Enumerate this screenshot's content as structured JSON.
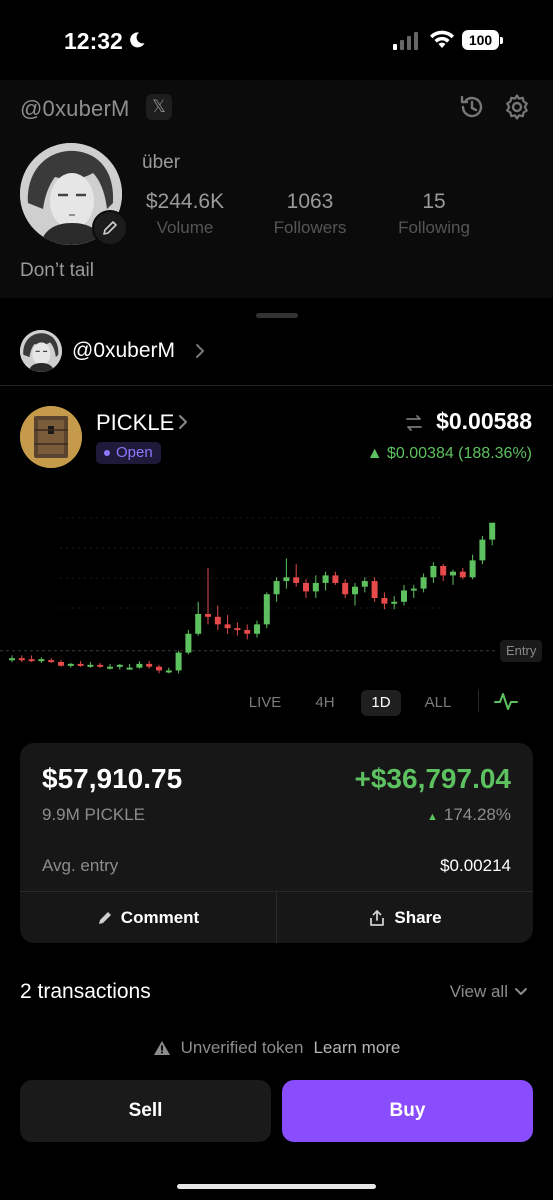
{
  "status_bar": {
    "time": "12:32",
    "battery": "100"
  },
  "profile": {
    "handle": "@0xuberM",
    "x_badge": "𝕏",
    "display_name": "über",
    "stats": [
      {
        "value": "$244.6K",
        "label": "Volume"
      },
      {
        "value": "1063",
        "label": "Followers"
      },
      {
        "value": "15",
        "label": "Following"
      }
    ],
    "bio": "Don’t tail"
  },
  "owner": {
    "handle": "@0xuberM"
  },
  "token": {
    "name": "PICKLE",
    "status": "Open",
    "price": "$0.00588",
    "change": "▲ $0.00384 (188.36%)"
  },
  "chart": {
    "entry_label": "Entry"
  },
  "chart_data": {
    "type": "candlestick",
    "x": [
      1,
      2,
      3,
      4,
      5,
      6,
      7,
      8,
      9,
      10,
      11,
      12,
      13,
      14,
      15,
      16,
      17,
      18,
      19,
      20,
      21,
      22,
      23,
      24,
      25,
      26,
      27,
      28,
      29,
      30,
      31,
      32,
      33,
      34,
      35,
      36,
      37,
      38,
      39,
      40,
      41,
      42,
      43,
      44,
      45,
      46,
      47,
      48,
      49,
      50
    ],
    "open": [
      0.00205,
      0.00206,
      0.00205,
      0.00204,
      0.00204,
      0.00202,
      0.00198,
      0.002,
      0.00199,
      0.00199,
      0.00197,
      0.00197,
      0.00195,
      0.00196,
      0.002,
      0.00197,
      0.00192,
      0.00193,
      0.00212,
      0.00232,
      0.00253,
      0.0025,
      0.00242,
      0.00238,
      0.00236,
      0.00232,
      0.00242,
      0.00274,
      0.00288,
      0.00292,
      0.00286,
      0.00277,
      0.00286,
      0.00294,
      0.00286,
      0.00274,
      0.00282,
      0.00288,
      0.0027,
      0.00264,
      0.00266,
      0.00278,
      0.0028,
      0.00292,
      0.00304,
      0.00294,
      0.00298,
      0.00292,
      0.0031,
      0.00332
    ],
    "high": [
      0.00209,
      0.00209,
      0.00209,
      0.00207,
      0.00206,
      0.00204,
      0.00201,
      0.00203,
      0.00202,
      0.00201,
      0.002,
      0.002,
      0.002,
      0.00203,
      0.00203,
      0.00199,
      0.00196,
      0.00214,
      0.00236,
      0.00266,
      0.00302,
      0.00262,
      0.00252,
      0.00244,
      0.00242,
      0.00246,
      0.00276,
      0.00292,
      0.00312,
      0.00306,
      0.0029,
      0.00294,
      0.00298,
      0.00298,
      0.0029,
      0.00286,
      0.00292,
      0.00292,
      0.00276,
      0.00272,
      0.00284,
      0.00284,
      0.00296,
      0.00308,
      0.00306,
      0.003,
      0.00302,
      0.00316,
      0.00336,
      0.00338
    ],
    "low": [
      0.00202,
      0.00202,
      0.00202,
      0.00201,
      0.00201,
      0.00197,
      0.00196,
      0.00197,
      0.00196,
      0.00196,
      0.00194,
      0.00194,
      0.00194,
      0.00195,
      0.00195,
      0.0019,
      0.0019,
      0.0019,
      0.0021,
      0.0023,
      0.00242,
      0.00236,
      0.00232,
      0.0023,
      0.00226,
      0.00228,
      0.00238,
      0.00266,
      0.0028,
      0.00282,
      0.0027,
      0.0027,
      0.00278,
      0.00284,
      0.0027,
      0.00262,
      0.00276,
      0.00266,
      0.00258,
      0.00258,
      0.00262,
      0.0027,
      0.00276,
      0.00286,
      0.00288,
      0.00284,
      0.0029,
      0.0029,
      0.00306,
      0.00326
    ],
    "close": [
      0.00206,
      0.00205,
      0.00204,
      0.00205,
      0.00202,
      0.00198,
      0.002,
      0.00199,
      0.00199,
      0.00198,
      0.00197,
      0.00199,
      0.00196,
      0.002,
      0.00197,
      0.00193,
      0.00193,
      0.00212,
      0.00232,
      0.00253,
      0.0025,
      0.00242,
      0.00238,
      0.00236,
      0.00232,
      0.00242,
      0.00274,
      0.00288,
      0.00292,
      0.00286,
      0.00277,
      0.00286,
      0.00294,
      0.00286,
      0.00274,
      0.00282,
      0.00288,
      0.0027,
      0.00264,
      0.00266,
      0.00278,
      0.0028,
      0.00292,
      0.00304,
      0.00294,
      0.00298,
      0.00292,
      0.0031,
      0.00332,
      0.0035
    ],
    "entry": 0.00214,
    "ylim": [
      0.00185,
      0.00355
    ],
    "up_color": "#5dc15f",
    "down_color": "#e64a4a"
  },
  "ranges": {
    "items": [
      "LIVE",
      "4H",
      "1D",
      "ALL"
    ],
    "selected": "1D"
  },
  "position": {
    "value": "$57,910.75",
    "pnl": "+$36,797.04",
    "holdings": "9.9M PICKLE",
    "pnl_pct": "174.28%",
    "avg_label": "Avg. entry",
    "avg_value": "$0.00214",
    "comment_label": "Comment",
    "share_label": "Share"
  },
  "transactions": {
    "count_label": "2 transactions",
    "view_all_label": "View all"
  },
  "warning": {
    "text": "Unverified token",
    "link": "Learn more"
  },
  "actions": {
    "sell_label": "Sell",
    "buy_label": "Buy"
  },
  "colors": {
    "accent": "#8a4dfd",
    "positive": "#5dc15f",
    "negative": "#e64a4a",
    "status_purple": "#8b78ff"
  }
}
